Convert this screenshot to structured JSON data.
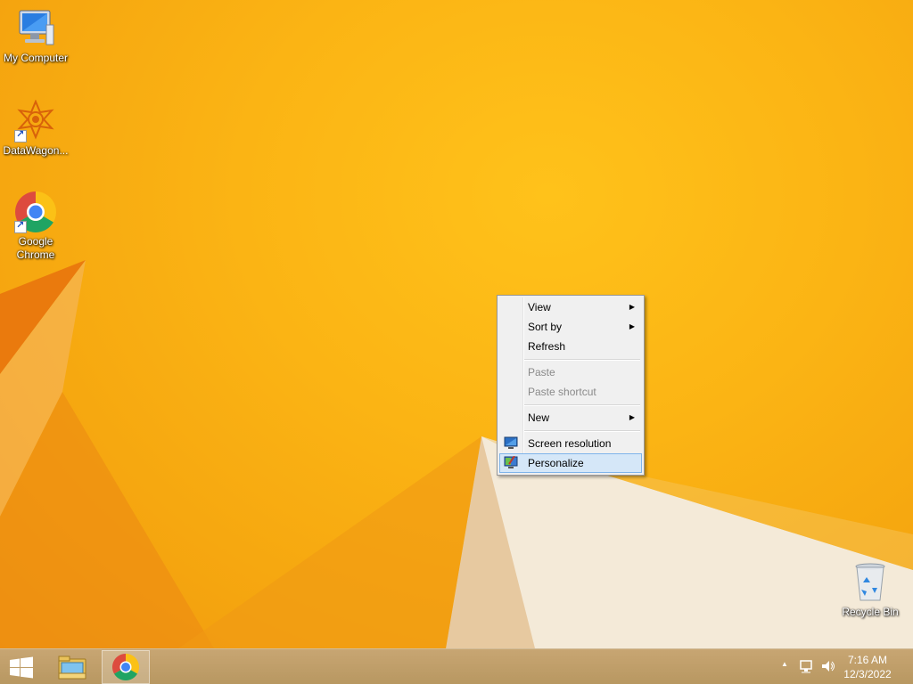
{
  "desktop": {
    "icons": [
      {
        "label": "My Computer",
        "icon": "computer-icon"
      },
      {
        "label": "DataWagon...",
        "icon": "datawagon-icon"
      },
      {
        "label_line1": "Google",
        "label_line2": "Chrome",
        "icon": "chrome-icon"
      },
      {
        "label": "Recycle Bin",
        "icon": "recycle-bin-icon"
      }
    ]
  },
  "context_menu": {
    "items": [
      {
        "label": "View",
        "submenu": true,
        "enabled": true
      },
      {
        "label": "Sort by",
        "submenu": true,
        "enabled": true
      },
      {
        "label": "Refresh",
        "enabled": true
      },
      {
        "label": "Paste",
        "enabled": false
      },
      {
        "label": "Paste shortcut",
        "enabled": false
      },
      {
        "label": "New",
        "submenu": true,
        "enabled": true
      },
      {
        "label": "Screen resolution",
        "icon": "monitor-icon",
        "enabled": true
      },
      {
        "label": "Personalize",
        "icon": "personalize-icon",
        "enabled": true,
        "highlighted": true
      }
    ],
    "submenu_arrow": "▶"
  },
  "taskbar": {
    "clock_time": "7:16 AM",
    "clock_date": "12/3/2022",
    "tray_expand": "▲",
    "pinned": [
      "start-button",
      "file-explorer-icon",
      "chrome-icon"
    ]
  },
  "colors": {
    "wallpaper": "#fbb414",
    "menu_highlight": "#d5e7f8",
    "menu_highlight_border": "#7eb4ea"
  }
}
